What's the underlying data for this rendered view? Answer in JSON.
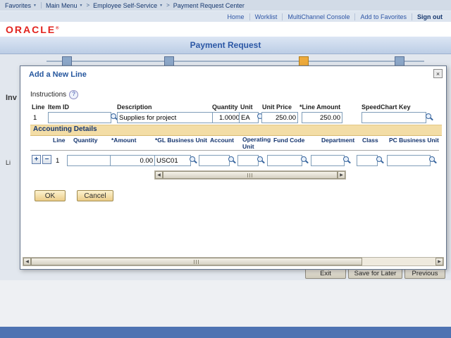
{
  "topnav": {
    "favorites_label": "Favorites",
    "main_menu_label": "Main Menu",
    "crumb1": "Employee Self-Service",
    "crumb2": "Payment Request Center",
    "caret": "▼",
    "sep": ">"
  },
  "utility_links": {
    "home": "Home",
    "worklist": "Worklist",
    "multichannel": "MultiChannel Console",
    "add_to_favorites": "Add to Favorites",
    "sign_out": "Sign out"
  },
  "brand": {
    "logo_text": "ORACLE",
    "registered_mark": "®"
  },
  "page": {
    "title": "Payment Request"
  },
  "background": {
    "invoice_fragment": "Inv",
    "line_fragment": "Li",
    "exit_button": "Exit",
    "save_for_later_button": "Save for Later",
    "previous_button": "Previous"
  },
  "modal": {
    "title": "Add a New Line",
    "close_icon": "×",
    "instructions_label": "Instructions",
    "help_icon": "?",
    "line": {
      "line_label": "Line",
      "line_value": "1",
      "item_id_label": "Item ID",
      "item_id_value": "",
      "description_label": "Description",
      "description_value": "Supplies for project",
      "quantity_label": "Quantity",
      "quantity_value": "1.0000",
      "unit_label": "Unit",
      "unit_value": "EA",
      "unit_price_label": "Unit Price",
      "unit_price_value": "250.00",
      "line_amount_label": "*Line Amount",
      "line_amount_value": "250.00",
      "speedchart_label": "SpeedChart Key",
      "speedchart_value": ""
    },
    "accounting": {
      "section_title": "Accounting Details",
      "columns": [
        "Line",
        "Quantity",
        "*Amount",
        "*GL Business Unit",
        "Account",
        "Operating Unit",
        "Fund Code",
        "Department",
        "Class",
        "PC Business Unit"
      ],
      "add_row_icon": "+",
      "delete_row_icon": "−",
      "row": {
        "line": "1",
        "quantity": "",
        "amount": "0.00",
        "gl_business_unit": "USC01",
        "account": "",
        "operating_unit": "",
        "fund_code": "",
        "department": "",
        "class": "",
        "pc_business_unit": ""
      }
    },
    "ok_button": "OK",
    "cancel_button": "Cancel"
  },
  "icons": {
    "scroll_left": "◀",
    "scroll_right": "▶"
  }
}
